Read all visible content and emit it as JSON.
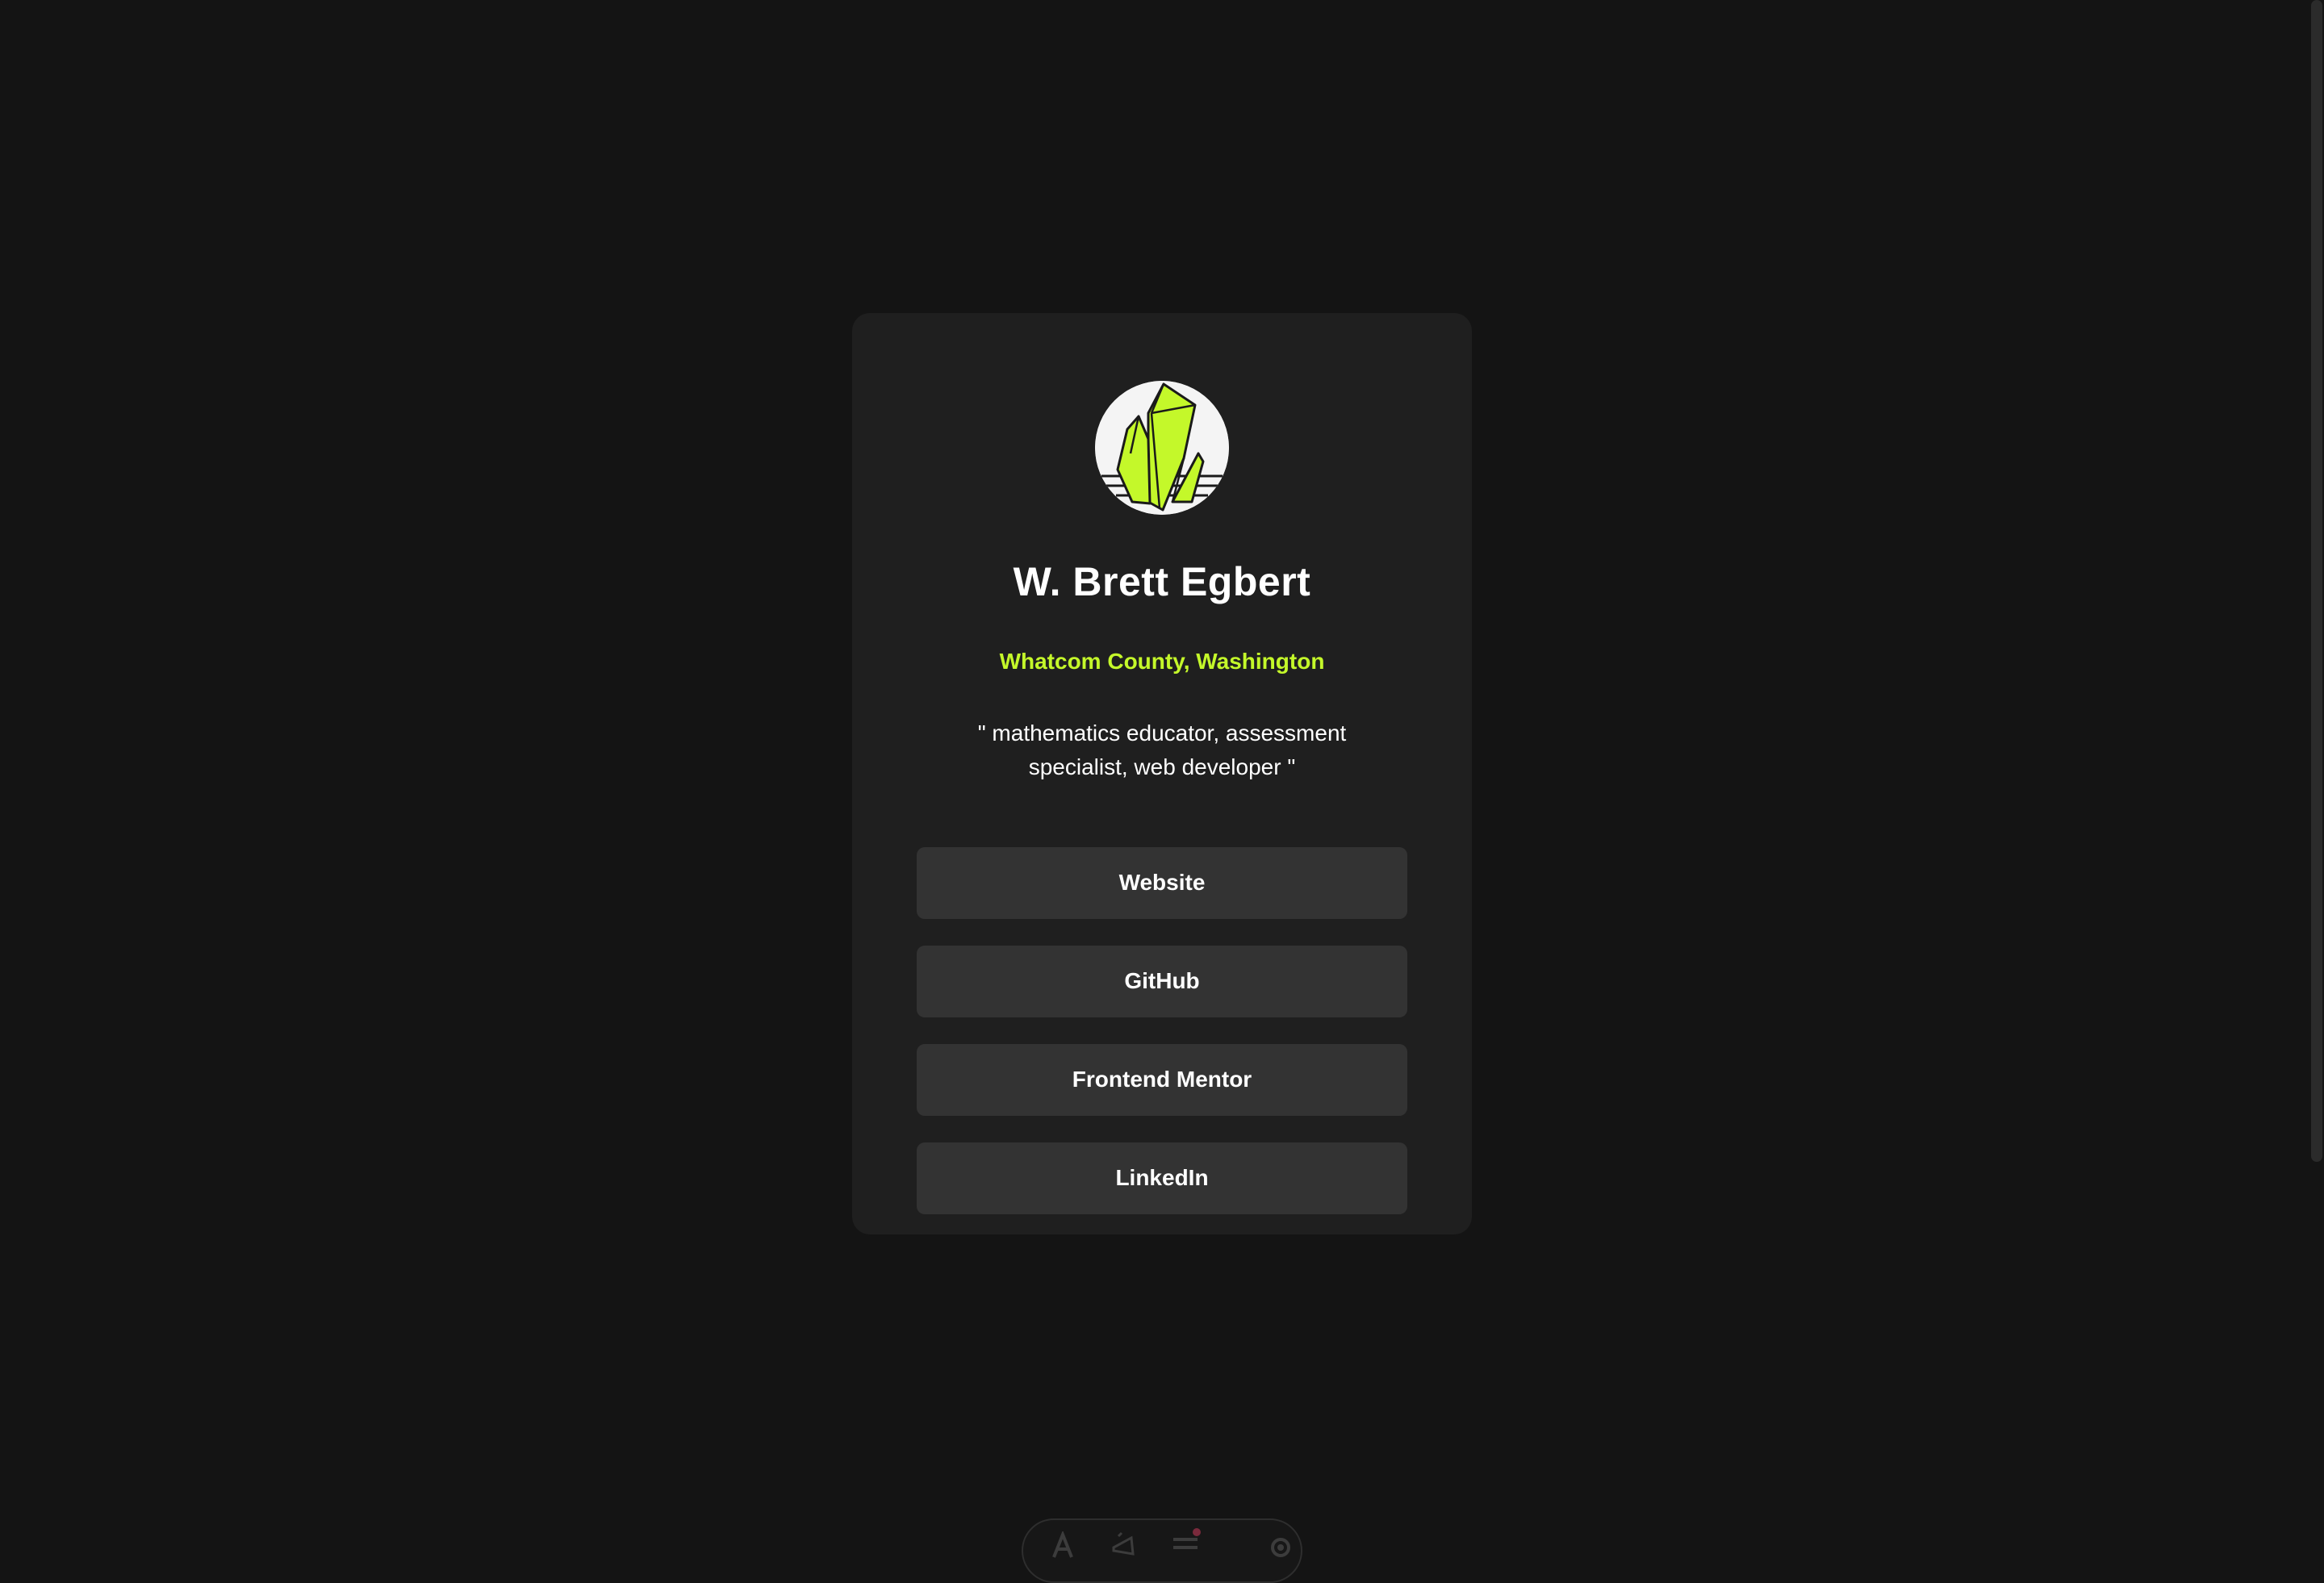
{
  "profile": {
    "name": "W. Brett Egbert",
    "location": "Whatcom County, Washington",
    "bio": "\" mathematics educator, assessment specialist, web developer \"",
    "avatar_icon": "crystal-logo-icon"
  },
  "links": [
    {
      "label": "Website"
    },
    {
      "label": "GitHub"
    },
    {
      "label": "Frontend Mentor"
    },
    {
      "label": "LinkedIn"
    }
  ],
  "toolbar": {
    "icons": [
      "accessibility-icon",
      "megaphone-icon",
      "menu-icon",
      "settings-icon"
    ]
  },
  "colors": {
    "background": "#141414",
    "card": "#1f1f1f",
    "button": "#333333",
    "accent": "#c4f82a",
    "text": "#ffffff"
  }
}
